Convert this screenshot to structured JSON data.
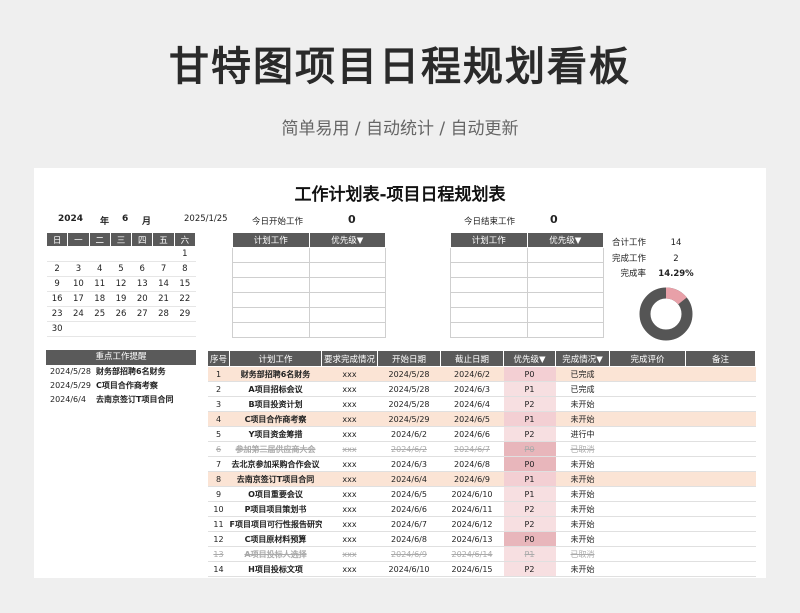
{
  "hero": {
    "title": "甘特图项目日程规划看板",
    "subtitle": "简单易用 / 自动统计 / 自动更新"
  },
  "sheet": {
    "title": "工作计划表-项目日程规划表",
    "year": "2024",
    "year_label": "年",
    "month": "6",
    "month_label": "月",
    "date": "2025/1/25",
    "today_start_label": "今日开始工作",
    "today_start_value": "0",
    "today_end_label": "今日结束工作",
    "today_end_value": "0"
  },
  "calendar": {
    "weekdays": [
      "日",
      "一",
      "二",
      "三",
      "四",
      "五",
      "六"
    ],
    "weeks": [
      [
        "",
        "",
        "",
        "",
        "",
        "",
        "1"
      ],
      [
        "2",
        "3",
        "4",
        "5",
        "6",
        "7",
        "8"
      ],
      [
        "9",
        "10",
        "11",
        "12",
        "13",
        "14",
        "15"
      ],
      [
        "16",
        "17",
        "18",
        "19",
        "20",
        "21",
        "22"
      ],
      [
        "23",
        "24",
        "25",
        "26",
        "27",
        "28",
        "29"
      ],
      [
        "30",
        "",
        "",
        "",
        "",
        "",
        ""
      ]
    ]
  },
  "mini_tables": {
    "col1": "计划工作",
    "col2": "优先级▼"
  },
  "stats": {
    "total_label": "合计工作",
    "total_value": "14",
    "done_label": "完成工作",
    "done_value": "2",
    "rate_label": "完成率",
    "rate_value": "14.29%",
    "rate_fraction": 0.1429,
    "colors": {
      "done": "#e8a0a8",
      "rest": "#555555"
    }
  },
  "reminders": {
    "title": "重点工作提醒",
    "items": [
      {
        "date": "2024/5/28",
        "text": "财务部招聘6名财务"
      },
      {
        "date": "2024/5/29",
        "text": "C项目合作商考察"
      },
      {
        "date": "2024/6/4",
        "text": "去南京签订T项目合同"
      }
    ]
  },
  "main_table": {
    "headers": [
      "序号",
      "计划工作",
      "要求完成情况",
      "开始日期",
      "截止日期",
      "优先级▼",
      "完成情况▼",
      "完成评价",
      "备注"
    ],
    "rows": [
      {
        "no": "1",
        "task": "财务部招聘6名财务",
        "req": "xxx",
        "start": "2024/5/28",
        "end": "2024/6/2",
        "pri": "P0",
        "status": "已完成",
        "style": "hl"
      },
      {
        "no": "2",
        "task": "A项目招标会议",
        "req": "xxx",
        "start": "2024/5/28",
        "end": "2024/6/3",
        "pri": "P1",
        "status": "已完成",
        "style": ""
      },
      {
        "no": "3",
        "task": "B项目投资计划",
        "req": "xxx",
        "start": "2024/5/28",
        "end": "2024/6/4",
        "pri": "P2",
        "status": "未开始",
        "style": ""
      },
      {
        "no": "4",
        "task": "C项目合作商考察",
        "req": "xxx",
        "start": "2024/5/29",
        "end": "2024/6/5",
        "pri": "P1",
        "status": "未开始",
        "style": "hl"
      },
      {
        "no": "5",
        "task": "Y项目资金筹措",
        "req": "xxx",
        "start": "2024/6/2",
        "end": "2024/6/6",
        "pri": "P2",
        "status": "进行中",
        "style": ""
      },
      {
        "no": "6",
        "task": "参加第三届供应商大会",
        "req": "xxx",
        "start": "2024/6/2",
        "end": "2024/6/7",
        "pri": "P0",
        "status": "已取消",
        "style": "cx"
      },
      {
        "no": "7",
        "task": "去北京参加采购合作会议",
        "req": "xxx",
        "start": "2024/6/3",
        "end": "2024/6/8",
        "pri": "P0",
        "status": "未开始",
        "style": ""
      },
      {
        "no": "8",
        "task": "去南京签订T项目合同",
        "req": "xxx",
        "start": "2024/6/4",
        "end": "2024/6/9",
        "pri": "P1",
        "status": "未开始",
        "style": "hl"
      },
      {
        "no": "9",
        "task": "O项目重要会议",
        "req": "xxx",
        "start": "2024/6/5",
        "end": "2024/6/10",
        "pri": "P1",
        "status": "未开始",
        "style": ""
      },
      {
        "no": "10",
        "task": "P项目项目策划书",
        "req": "xxx",
        "start": "2024/6/6",
        "end": "2024/6/11",
        "pri": "P2",
        "status": "未开始",
        "style": ""
      },
      {
        "no": "11",
        "task": "F项目项目可行性报告研究",
        "req": "xxx",
        "start": "2024/6/7",
        "end": "2024/6/12",
        "pri": "P2",
        "status": "未开始",
        "style": ""
      },
      {
        "no": "12",
        "task": "C项目原材料预算",
        "req": "xxx",
        "start": "2024/6/8",
        "end": "2024/6/13",
        "pri": "P0",
        "status": "未开始",
        "style": ""
      },
      {
        "no": "13",
        "task": "A项目投标人选择",
        "req": "xxx",
        "start": "2024/6/9",
        "end": "2024/6/14",
        "pri": "P1",
        "status": "已取消",
        "style": "cx"
      },
      {
        "no": "14",
        "task": "H项目投标文项",
        "req": "xxx",
        "start": "2024/6/10",
        "end": "2024/6/15",
        "pri": "P2",
        "status": "未开始",
        "style": ""
      }
    ]
  }
}
